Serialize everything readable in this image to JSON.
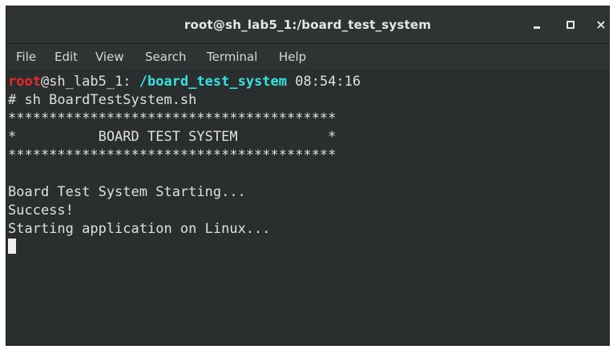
{
  "window": {
    "title": "root@sh_lab5_1:/board_test_system",
    "minimize_icon": "minimize-icon",
    "maximize_icon": "maximize-icon",
    "close_glyph": "×"
  },
  "menubar": {
    "items": [
      "File",
      "Edit",
      "View",
      "Search",
      "Terminal",
      "Help"
    ]
  },
  "terminal": {
    "prompt": {
      "user": "root",
      "host": "@sh_lab5_1: ",
      "path": "/board_test_system",
      "time": " 08:54:16"
    },
    "command": "# sh BoardTestSystem.sh",
    "banner_top": "****************************************",
    "banner_middle": "*          BOARD TEST SYSTEM           *",
    "banner_bottom": "****************************************",
    "blank": "",
    "output": [
      "Board Test System Starting...",
      "Success!",
      "Starting application on Linux..."
    ]
  },
  "colors": {
    "background": "#2b2e2f",
    "prompt_user": "#ef2929",
    "prompt_path": "#34e2e2",
    "text": "#e0e0e0"
  }
}
